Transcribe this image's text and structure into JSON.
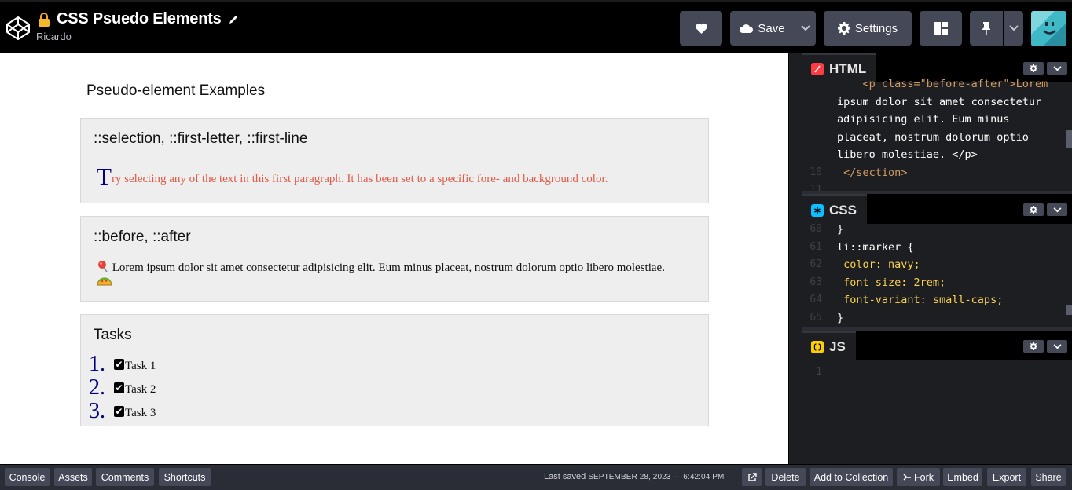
{
  "header": {
    "title": "CSS Psuedo Elements",
    "author": "Ricardo",
    "save_label": "Save",
    "settings_label": "Settings"
  },
  "preview": {
    "heading": "Pseudo-element Examples",
    "section1": {
      "heading": "::selection, ::first-letter, ::first-line",
      "first_letter": "T",
      "text": "ry selecting any of the text in this first paragraph. It has been set to a specific fore- and background color."
    },
    "section2": {
      "heading": "::before, ::after",
      "text": " Lorem ipsum dolor sit amet consectetur adipisicing elit. Eum minus placeat, nostrum dolorum optio libero molestiae. "
    },
    "section3": {
      "heading": "Tasks",
      "tasks": [
        {
          "num": "1.",
          "label": "Task 1"
        },
        {
          "num": "2.",
          "label": "Task 2"
        },
        {
          "num": "3.",
          "label": "Task 3"
        }
      ]
    }
  },
  "editors": {
    "html": {
      "label": "HTML",
      "lines": [
        {
          "n": "",
          "t": "    <p class=\"before-after\">Lorem"
        },
        {
          "n": "",
          "t": "ipsum dolor sit amet consectetur"
        },
        {
          "n": "",
          "t": "adipisicing elit. Eum minus"
        },
        {
          "n": "",
          "t": "placeat, nostrum dolorum optio"
        },
        {
          "n": "",
          "t": "libero molestiae. </p>"
        },
        {
          "n": "10",
          "t": " </section>"
        },
        {
          "n": "11",
          "t": ""
        }
      ]
    },
    "css": {
      "label": "CSS",
      "lines": [
        {
          "n": "60",
          "t": "}"
        },
        {
          "n": "61",
          "t": "li::marker {"
        },
        {
          "n": "62",
          "t": " color: navy;"
        },
        {
          "n": "63",
          "t": " font-size: 2rem;"
        },
        {
          "n": "64",
          "t": " font-variant: small-caps;"
        },
        {
          "n": "65",
          "t": "}"
        }
      ]
    },
    "js": {
      "label": "JS",
      "lines": [
        {
          "n": "1",
          "t": ""
        }
      ]
    }
  },
  "footer": {
    "console": "Console",
    "assets": "Assets",
    "comments": "Comments",
    "shortcuts": "Shortcuts",
    "last_saved_label": "Last saved",
    "last_saved_time": "SEPTEMBER 28, 2023 — 6:42:04 PM",
    "delete": "Delete",
    "add_to_collection": "Add to Collection",
    "fork": "Fork",
    "embed": "Embed",
    "export": "Export",
    "share": "Share"
  },
  "colors": {
    "header_bg": "#000000",
    "button_bg": "#444857",
    "footer_bg": "#2b2d36",
    "editor_bg": "#1d1e22",
    "first_line_color": "#e05a47",
    "marker_color": "navy",
    "html_badge": "#ff3c41",
    "css_badge": "#0ebeff",
    "js_badge": "#fcd000"
  },
  "icons": [
    "codepen-logo-icon",
    "lock-icon",
    "edit-pencil-icon",
    "heart-icon",
    "cloud-icon",
    "chevron-down-icon",
    "gear-icon",
    "layout-icon",
    "pin-icon",
    "external-link-icon",
    "fork-icon"
  ]
}
